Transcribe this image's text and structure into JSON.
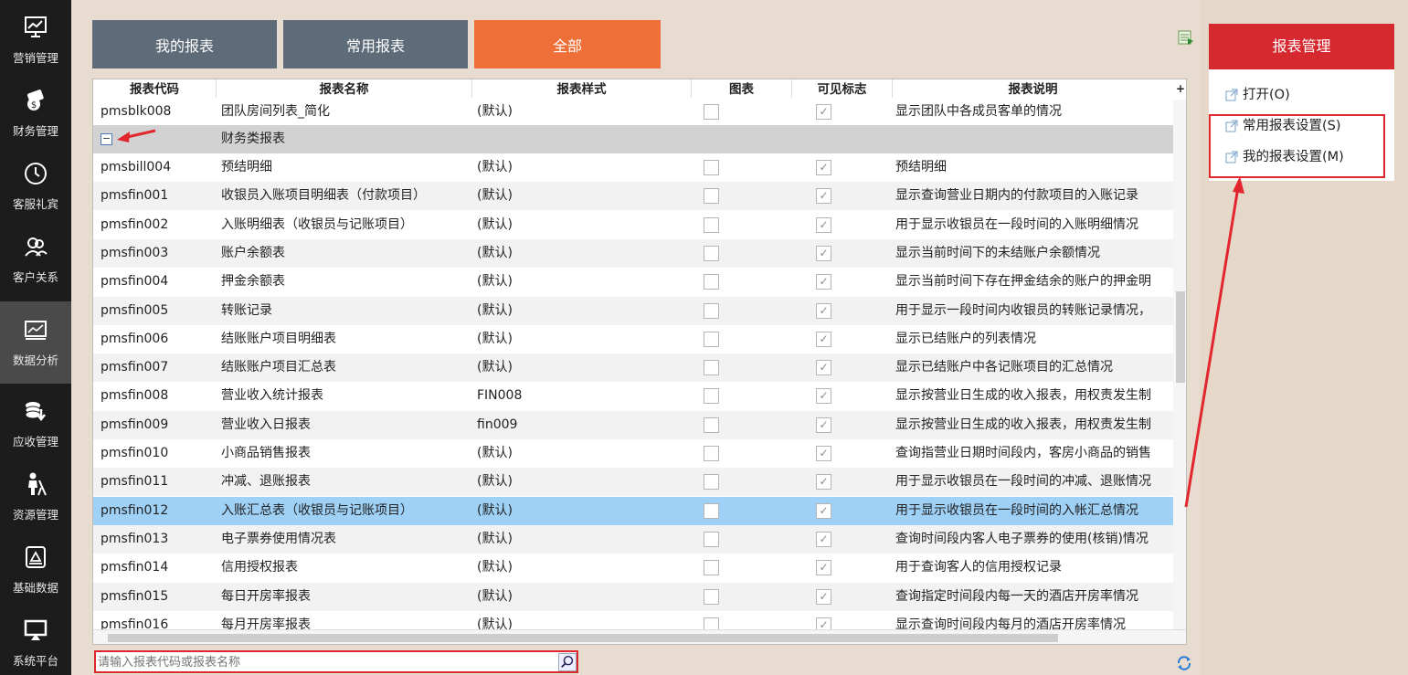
{
  "sidebar": {
    "items": [
      {
        "label": "营销管理",
        "icon": "marketing-chart-icon",
        "active": false
      },
      {
        "label": "财务管理",
        "icon": "finance-money-icon",
        "active": false
      },
      {
        "label": "客服礼宾",
        "icon": "clock-icon",
        "active": false
      },
      {
        "label": "客户关系",
        "icon": "users-icon",
        "active": false
      },
      {
        "label": "数据分析",
        "icon": "data-analysis-icon",
        "active": true
      },
      {
        "label": "应收管理",
        "icon": "receivable-coins-icon",
        "active": false
      },
      {
        "label": "资源管理",
        "icon": "resource-person-icon",
        "active": false
      },
      {
        "label": "基础数据",
        "icon": "basic-data-icon",
        "active": false
      },
      {
        "label": "系统平台",
        "icon": "system-platform-icon",
        "active": false
      }
    ]
  },
  "tabs": [
    {
      "label": "我的报表",
      "active": false
    },
    {
      "label": "常用报表",
      "active": false
    },
    {
      "label": "全部",
      "active": true
    }
  ],
  "grid": {
    "columns": [
      "报表代码",
      "报表名称",
      "报表样式",
      "图表",
      "可见标志",
      "报表说明"
    ],
    "head_plus": "+",
    "partial_top_row": {
      "code": "pmsblk008",
      "name": "团队房间列表_简化",
      "style": "(默认)",
      "chart": false,
      "visible": true,
      "desc": "显示团队中各成员客单的情况"
    },
    "group": {
      "label": "财务类报表",
      "toggle": "−"
    },
    "rows": [
      {
        "code": "pmsbill004",
        "name": "预结明细",
        "style": "(默认)",
        "chart": false,
        "visible": true,
        "desc": "预结明细"
      },
      {
        "code": "pmsfin001",
        "name": "收银员入账项目明细表（付款项目）",
        "style": "(默认)",
        "chart": false,
        "visible": true,
        "desc": "显示查询营业日期内的付款项目的入账记录"
      },
      {
        "code": "pmsfin002",
        "name": "入账明细表（收银员与记账项目）",
        "style": "(默认)",
        "chart": false,
        "visible": true,
        "desc": "用于显示收银员在一段时间的入账明细情况"
      },
      {
        "code": "pmsfin003",
        "name": "账户余额表",
        "style": "(默认)",
        "chart": false,
        "visible": true,
        "desc": "显示当前时间下的未结账户余额情况"
      },
      {
        "code": "pmsfin004",
        "name": "押金余额表",
        "style": "(默认)",
        "chart": false,
        "visible": true,
        "desc": "显示当前时间下存在押金结余的账户的押金明"
      },
      {
        "code": "pmsfin005",
        "name": "转账记录",
        "style": "(默认)",
        "chart": false,
        "visible": true,
        "desc": "用于显示一段时间内收银员的转账记录情况，"
      },
      {
        "code": "pmsfin006",
        "name": "结账账户项目明细表",
        "style": "(默认)",
        "chart": false,
        "visible": true,
        "desc": "显示已结账户的列表情况"
      },
      {
        "code": "pmsfin007",
        "name": "结账账户项目汇总表",
        "style": "(默认)",
        "chart": false,
        "visible": true,
        "desc": "显示已结账户中各记账项目的汇总情况"
      },
      {
        "code": "pmsfin008",
        "name": "营业收入统计报表",
        "style": "FIN008",
        "chart": false,
        "visible": true,
        "desc": "显示按营业日生成的收入报表，用权责发生制"
      },
      {
        "code": "pmsfin009",
        "name": "营业收入日报表",
        "style": "fin009",
        "chart": false,
        "visible": true,
        "desc": "显示按营业日生成的收入报表，用权责发生制"
      },
      {
        "code": "pmsfin010",
        "name": "小商品销售报表",
        "style": "(默认)",
        "chart": false,
        "visible": true,
        "desc": "查询指营业日期时间段内，客房小商品的销售"
      },
      {
        "code": "pmsfin011",
        "name": "冲减、退账报表",
        "style": "(默认)",
        "chart": false,
        "visible": true,
        "desc": "用于显示收银员在一段时间的冲减、退账情况"
      },
      {
        "code": "pmsfin012",
        "name": "入账汇总表（收银员与记账项目）",
        "style": "(默认)",
        "chart": false,
        "visible": true,
        "desc": "用于显示收银员在一段时间的入帐汇总情况",
        "selected": true
      },
      {
        "code": "pmsfin013",
        "name": "电子票券使用情况表",
        "style": "(默认)",
        "chart": false,
        "visible": true,
        "desc": "查询时间段内客人电子票券的使用(核销)情况"
      },
      {
        "code": "pmsfin014",
        "name": "信用授权报表",
        "style": "(默认)",
        "chart": false,
        "visible": true,
        "desc": "用于查询客人的信用授权记录"
      },
      {
        "code": "pmsfin015",
        "name": "每日开房率报表",
        "style": "(默认)",
        "chart": false,
        "visible": true,
        "desc": "查询指定时间段内每一天的酒店开房率情况"
      },
      {
        "code": "pmsfin016",
        "name": "每月开房率报表",
        "style": "(默认)",
        "chart": false,
        "visible": true,
        "desc": "显示查询时间段内每月的酒店开房率情况"
      }
    ]
  },
  "search": {
    "placeholder": "请输入报表代码或报表名称",
    "value": ""
  },
  "right_panel": {
    "title": "报表管理",
    "menu": [
      {
        "label": "打开(O)"
      },
      {
        "label": "常用报表设置(S)"
      },
      {
        "label": "我的报表设置(M)"
      }
    ]
  },
  "colors": {
    "accent_red": "#d5282f",
    "highlight_red": "#e1262e",
    "tab_orange": "#ee6f38",
    "tab_grey": "#5e6b78",
    "selected_row": "#9fd0f6"
  }
}
